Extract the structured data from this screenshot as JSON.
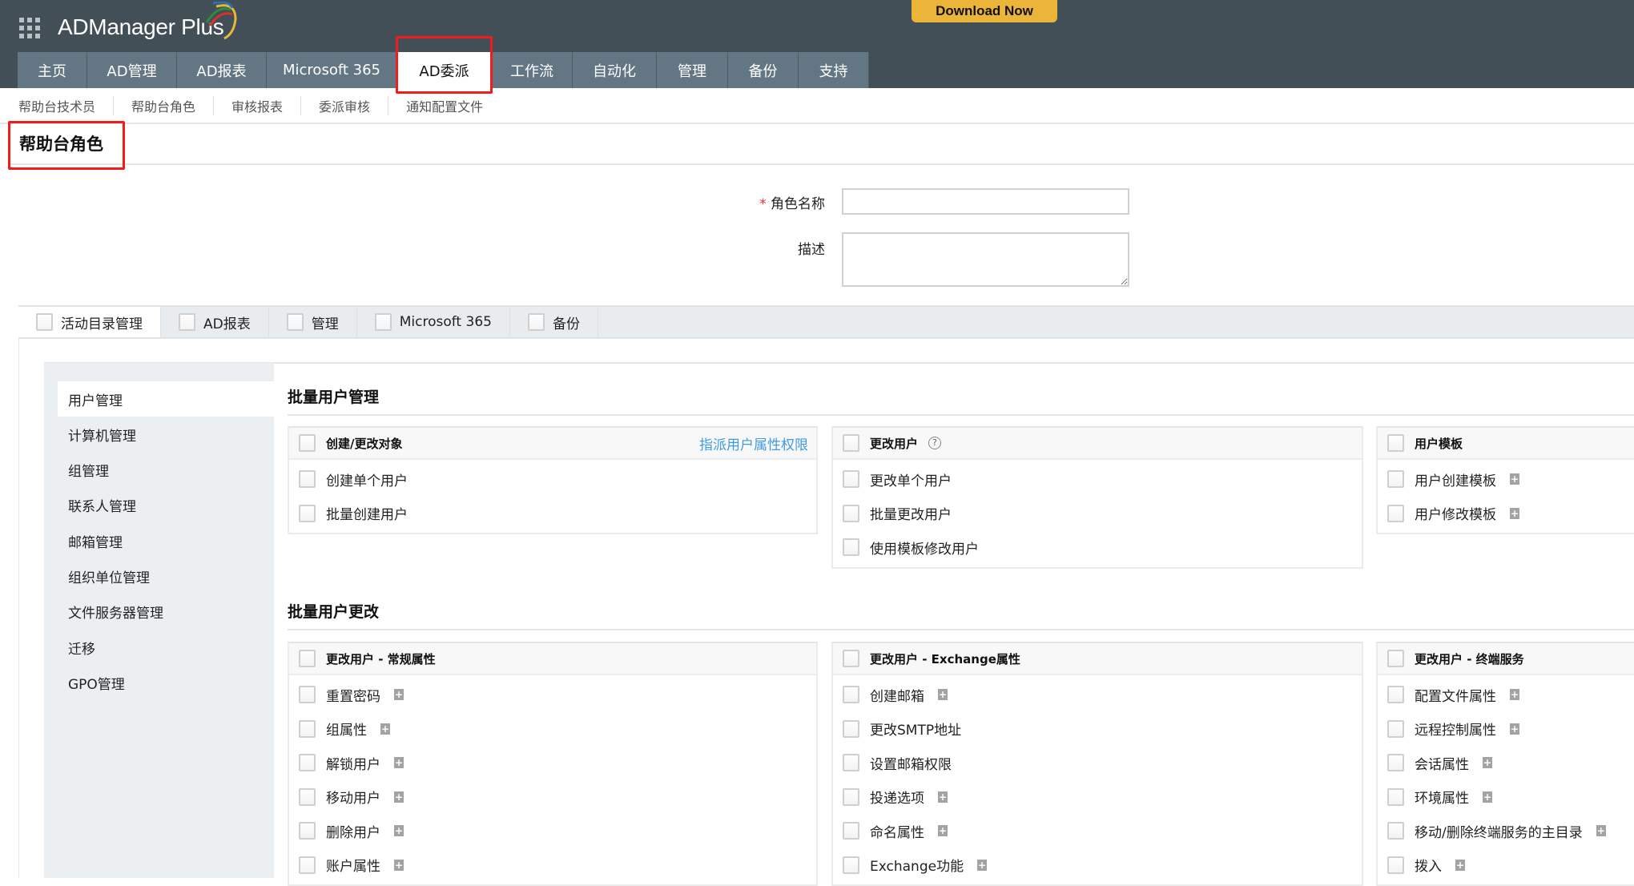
{
  "header": {
    "app_name": "ADManager Plus",
    "download_label": "Download Now"
  },
  "nav": {
    "tabs": [
      {
        "label": "主页",
        "width": 87
      },
      {
        "label": "AD管理",
        "width": 112
      },
      {
        "label": "AD报表",
        "width": 112
      },
      {
        "label": "Microsoft 365",
        "width": 163
      },
      {
        "label": "AD委派",
        "width": 118,
        "active": true
      },
      {
        "label": "工作流",
        "width": 101
      },
      {
        "label": "自动化",
        "width": 105
      },
      {
        "label": "管理",
        "width": 89
      },
      {
        "label": "备份",
        "width": 88
      },
      {
        "label": "支持",
        "width": 88
      }
    ]
  },
  "subnav": {
    "items": [
      "帮助台技术员",
      "帮助台角色",
      "审核报表",
      "委派审核",
      "通知配置文件"
    ]
  },
  "page_title": "帮助台角色",
  "form": {
    "required_mark": "*",
    "role_name_label": "角色名称",
    "role_name_value": "",
    "description_label": "描述",
    "description_value": ""
  },
  "category_tabs": [
    {
      "label": "活动目录管理",
      "active": true
    },
    {
      "label": "AD报表"
    },
    {
      "label": "管理"
    },
    {
      "label": "Microsoft 365"
    },
    {
      "label": "备份"
    }
  ],
  "sidebar": {
    "items": [
      {
        "label": "用户管理",
        "active": true
      },
      {
        "label": "计算机管理"
      },
      {
        "label": "组管理"
      },
      {
        "label": "联系人管理"
      },
      {
        "label": "邮箱管理"
      },
      {
        "label": "组织单位管理"
      },
      {
        "label": "文件服务器管理"
      },
      {
        "label": "迁移"
      },
      {
        "label": "GPO管理"
      }
    ]
  },
  "sections": [
    {
      "title": "批量用户管理",
      "cards": [
        {
          "title": "创建/更改对象",
          "link": "指派用户属性权限",
          "items": [
            {
              "label": "创建单个用户"
            },
            {
              "label": "批量创建用户"
            }
          ]
        },
        {
          "title": "更改用户",
          "help": "?",
          "items": [
            {
              "label": "更改单个用户"
            },
            {
              "label": "批量更改用户"
            },
            {
              "label": "使用模板修改用户"
            }
          ]
        },
        {
          "title": "用户模板",
          "items": [
            {
              "label": "用户创建模板",
              "expand": true
            },
            {
              "label": "用户修改模板",
              "expand": true
            }
          ]
        }
      ]
    },
    {
      "title": "批量用户更改",
      "cards": [
        {
          "title": "更改用户 - 常规属性",
          "items": [
            {
              "label": "重置密码",
              "expand": true
            },
            {
              "label": "组属性",
              "expand": true
            },
            {
              "label": "解锁用户",
              "expand": true
            },
            {
              "label": "移动用户",
              "expand": true
            },
            {
              "label": "删除用户",
              "expand": true
            },
            {
              "label": "账户属性",
              "expand": true
            }
          ]
        },
        {
          "title": "更改用户 - Exchange属性",
          "items": [
            {
              "label": "创建邮箱",
              "expand": true
            },
            {
              "label": "更改SMTP地址"
            },
            {
              "label": "设置邮箱权限"
            },
            {
              "label": "投递选项",
              "expand": true
            },
            {
              "label": "命名属性",
              "expand": true
            },
            {
              "label": "Exchange功能",
              "expand": true
            }
          ]
        },
        {
          "title": "更改用户 - 终端服务",
          "items": [
            {
              "label": "配置文件属性",
              "expand": true
            },
            {
              "label": "远程控制属性",
              "expand": true
            },
            {
              "label": "会话属性",
              "expand": true
            },
            {
              "label": "环境属性",
              "expand": true
            },
            {
              "label": "移动/删除终端服务的主目录",
              "expand": true
            },
            {
              "label": "拨入",
              "expand": true
            }
          ]
        }
      ]
    }
  ],
  "plus_glyph": "+"
}
